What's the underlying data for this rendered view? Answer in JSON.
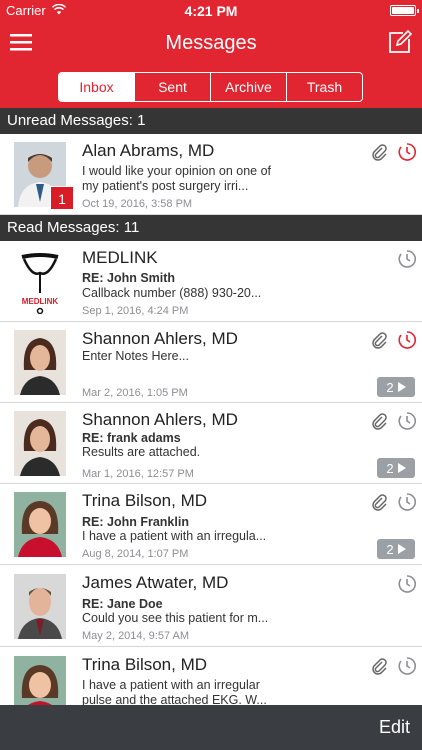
{
  "status_bar": {
    "carrier": "Carrier",
    "time": "4:21 PM"
  },
  "nav": {
    "title": "Messages"
  },
  "tabs": [
    {
      "label": "Inbox",
      "active": true
    },
    {
      "label": "Sent",
      "active": false
    },
    {
      "label": "Archive",
      "active": false
    },
    {
      "label": "Trash",
      "active": false
    }
  ],
  "sections": {
    "unread": {
      "label": "Unread Messages: 1"
    },
    "read": {
      "label": "Read Messages: 11"
    }
  },
  "colors": {
    "brand": "#e12531",
    "section_bg": "#353535",
    "toolbar_bg": "#3a3d42",
    "badge_red": "#d81c28",
    "clock_red": "#e12531",
    "clock_grey": "#8e8e93"
  },
  "unread_messages": [
    {
      "name": "Alan Abrams, MD",
      "preview": "I would like your opinion on one of my patient's post surgery irri...",
      "date": "Oct 19, 2016, 3:58 PM",
      "badge": "1",
      "attachment": true,
      "clock": "red"
    }
  ],
  "read_messages": [
    {
      "name": "MEDLINK",
      "subject": "RE: John Smith",
      "preview": "Callback number (888) 930-20...",
      "date": "Sep 1, 2016, 4:24 PM",
      "attachment": false,
      "clock": "grey",
      "avatar_text": "MEDLINK"
    },
    {
      "name": "Shannon Ahlers, MD",
      "preview": "Enter Notes Here...",
      "date": "Mar 2, 2016, 1:05 PM",
      "attachment": true,
      "clock": "red",
      "thread_count": "2"
    },
    {
      "name": "Shannon Ahlers, MD",
      "subject": "RE: frank adams",
      "preview": "Results are attached.",
      "date": "Mar 1, 2016, 12:57 PM",
      "attachment": true,
      "clock": "grey",
      "thread_count": "2"
    },
    {
      "name": "Trina Bilson, MD",
      "subject": "RE: John Franklin",
      "preview": "I have a patient with an irregula...",
      "date": "Aug 8, 2014, 1:07 PM",
      "attachment": true,
      "clock": "grey",
      "thread_count": "2"
    },
    {
      "name": "James Atwater, MD",
      "subject": "RE: Jane Doe",
      "preview": "Could you see this patient for m...",
      "date": "May 2, 2014, 9:57 AM",
      "attachment": false,
      "clock": "grey"
    },
    {
      "name": "Trina Bilson, MD",
      "preview": "I have a patient with an irregular pulse and the attached EKG. W...",
      "attachment": true,
      "clock": "grey"
    }
  ],
  "toolbar": {
    "edit_label": "Edit"
  }
}
